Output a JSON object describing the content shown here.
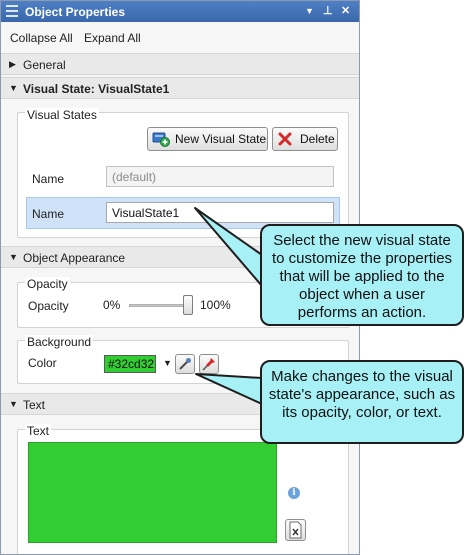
{
  "window": {
    "title": "Object Properties",
    "dropdown_glyph": "▼",
    "pin_glyph": "⊥",
    "close_glyph": "✕"
  },
  "toolbar": {
    "collapse_all": "Collapse All",
    "expand_all": "Expand All"
  },
  "sections": {
    "general": {
      "label": "General",
      "arrow": "▶"
    },
    "visual_state": {
      "label": "Visual State: VisualState1",
      "arrow": "▼"
    },
    "object_appearance": {
      "label": "Object Appearance",
      "arrow": "▼"
    },
    "text": {
      "label": "Text",
      "arrow": "▼"
    }
  },
  "visual_states": {
    "group_title": "Visual States",
    "new_button": "New Visual State",
    "delete_button": "Delete",
    "rows": [
      {
        "label": "Name",
        "value": "(default)"
      },
      {
        "label": "Name",
        "value": "VisualState1"
      }
    ]
  },
  "opacity": {
    "group_title": "Opacity",
    "label": "Opacity",
    "min_label": "0%",
    "max_label": "100%",
    "value_percent": 100
  },
  "background": {
    "group_title": "Background",
    "label": "Color",
    "value": "#32cd32",
    "dropdown_glyph": "▼"
  },
  "text_group": {
    "group_title": "Text",
    "info_glyph": "i"
  },
  "callouts": {
    "visual_state": "Select the new visual state to customize the properties that will be applied to the object when a user performs an action.",
    "appearance": "Make changes to the visual state's appearance, such as its opacity, color, or text."
  },
  "colors": {
    "title_bar": "#3a67ac",
    "selected_row": "#cfe2f7",
    "background_color": "#32cd32",
    "callout_fill": "#a6f0f6"
  },
  "icons": {
    "new_state": "add-visual-state-icon",
    "delete": "red-x-icon",
    "eyedropper": "eyedropper-icon",
    "pin": "pin-icon",
    "info": "info-icon",
    "text_editor": "text-editor-icon"
  }
}
